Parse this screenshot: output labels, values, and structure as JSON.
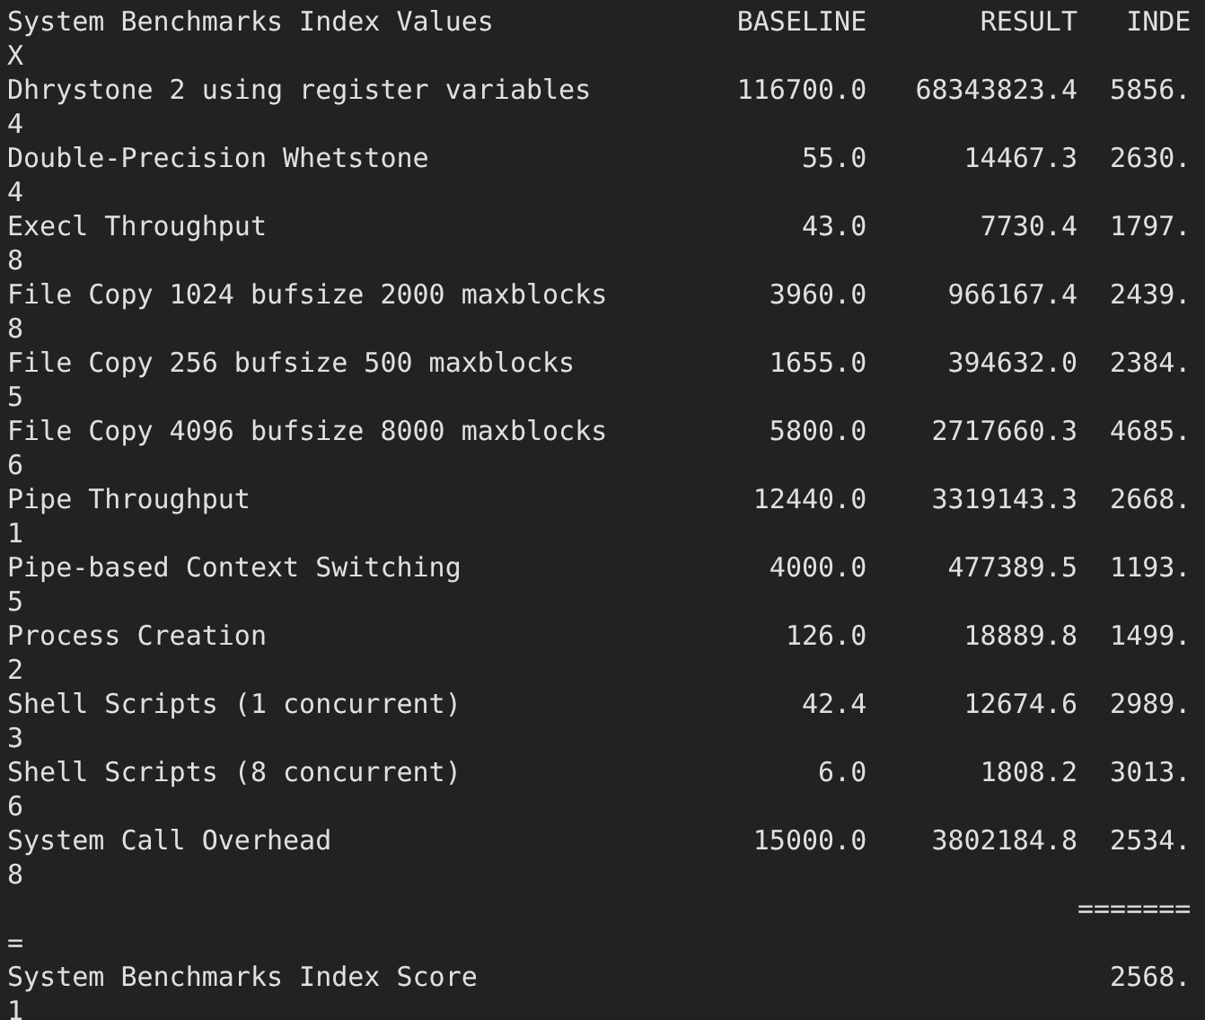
{
  "header": {
    "title": "System Benchmarks Index Values",
    "columns": [
      "BASELINE",
      "RESULT",
      "INDE"
    ],
    "wrap": "X"
  },
  "rows": [
    {
      "name": "Dhrystone 2 using register variables",
      "baseline": "116700.0",
      "result": "68343823.4",
      "index": "5856.",
      "wrap": "4"
    },
    {
      "name": "Double-Precision Whetstone",
      "baseline": "55.0",
      "result": "14467.3",
      "index": "2630.",
      "wrap": "4"
    },
    {
      "name": "Execl Throughput",
      "baseline": "43.0",
      "result": "7730.4",
      "index": "1797.",
      "wrap": "8"
    },
    {
      "name": "File Copy 1024 bufsize 2000 maxblocks",
      "baseline": "3960.0",
      "result": "966167.4",
      "index": "2439.",
      "wrap": "8"
    },
    {
      "name": "File Copy 256 bufsize 500 maxblocks",
      "baseline": "1655.0",
      "result": "394632.0",
      "index": "2384.",
      "wrap": "5"
    },
    {
      "name": "File Copy 4096 bufsize 8000 maxblocks",
      "baseline": "5800.0",
      "result": "2717660.3",
      "index": "4685.",
      "wrap": "6"
    },
    {
      "name": "Pipe Throughput",
      "baseline": "12440.0",
      "result": "3319143.3",
      "index": "2668.",
      "wrap": "1"
    },
    {
      "name": "Pipe-based Context Switching",
      "baseline": "4000.0",
      "result": "477389.5",
      "index": "1193.",
      "wrap": "5"
    },
    {
      "name": "Process Creation",
      "baseline": "126.0",
      "result": "18889.8",
      "index": "1499.",
      "wrap": "2"
    },
    {
      "name": "Shell Scripts (1 concurrent)",
      "baseline": "42.4",
      "result": "12674.6",
      "index": "2989.",
      "wrap": "3"
    },
    {
      "name": "Shell Scripts (8 concurrent)",
      "baseline": "6.0",
      "result": "1808.2",
      "index": "3013.",
      "wrap": "6"
    },
    {
      "name": "System Call Overhead",
      "baseline": "15000.0",
      "result": "3802184.8",
      "index": "2534.",
      "wrap": "8"
    }
  ],
  "separator": {
    "text": "=======",
    "wrap": "="
  },
  "score": {
    "name": "System Benchmarks Index Score",
    "index": "2568.",
    "wrap": "1"
  }
}
